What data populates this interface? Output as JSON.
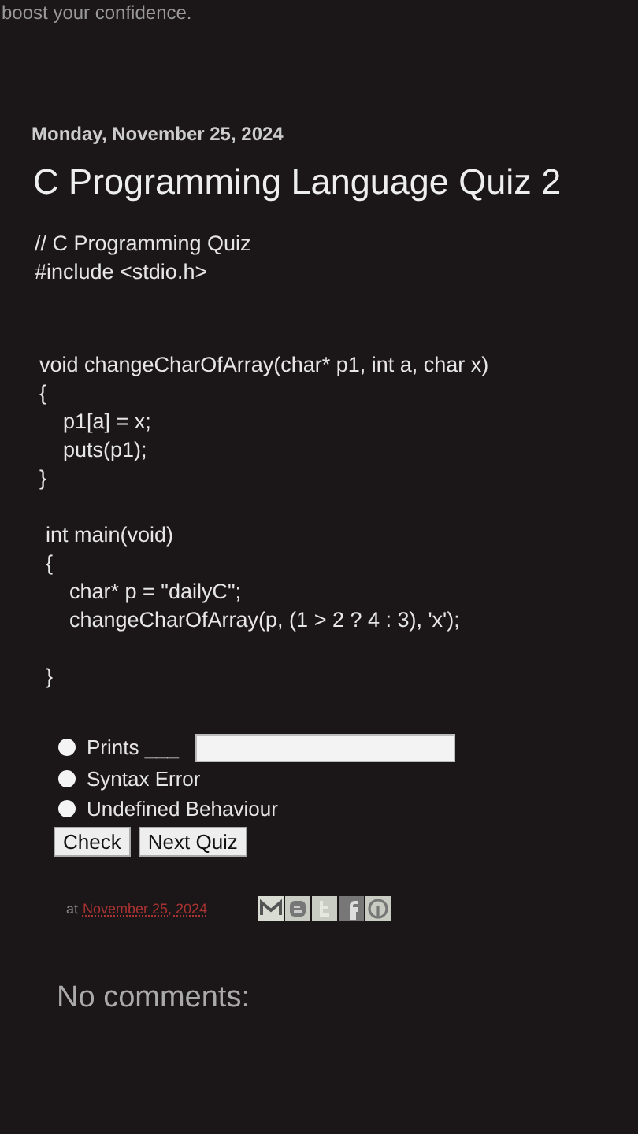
{
  "tagline": "boost your confidence.",
  "post": {
    "date": "Monday, November 25, 2024",
    "title": "C Programming Language Quiz 2",
    "code_header": [
      "// C Programming Quiz",
      "#include <stdio.h>"
    ],
    "code_blocks": [
      {
        "lines": [
          {
            "text": "void changeCharOfArray(char* p1, int a, char x)",
            "indented": false
          },
          {
            "text": "{",
            "indented": false
          },
          {
            "text": "p1[a] = x;",
            "indented": true
          },
          {
            "text": "puts(p1);",
            "indented": true
          },
          {
            "text": "}",
            "indented": false
          }
        ]
      },
      {
        "lines": [
          {
            "text": "int main(void)",
            "indented": false
          },
          {
            "text": "{",
            "indented": false
          },
          {
            "text": "char* p = \"dailyC\";",
            "indented": true
          },
          {
            "text": "changeCharOfArray(p, (1 > 2 ? 4 : 3), 'x');",
            "indented": true
          },
          {
            "text": "}",
            "indented": false
          }
        ]
      }
    ],
    "options": [
      {
        "label": "Prints ___",
        "selected": false,
        "kind": "input"
      },
      {
        "label": "Syntax Error",
        "selected": false,
        "kind": "plain"
      },
      {
        "label": "Undefined Behaviour",
        "selected": false,
        "kind": "plain"
      }
    ],
    "buttons": [
      "Check",
      "Next Quiz"
    ],
    "footer": {
      "prefix": "at",
      "link": "November 25, 2024"
    },
    "comments_heading": "No comments:"
  }
}
